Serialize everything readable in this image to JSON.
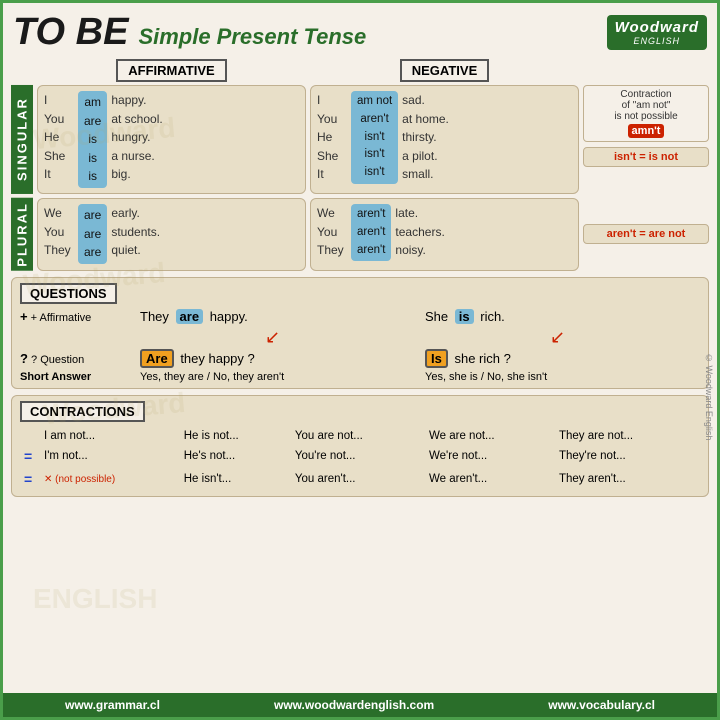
{
  "header": {
    "title_tobe": "TO BE",
    "title_sub": "Simple Present Tense",
    "logo": "Woodward",
    "logo_sub": "ENGLISH"
  },
  "col_headers": {
    "affirmative": "AFFIRMATIVE",
    "negative": "NEGATIVE"
  },
  "singular": {
    "label": "SINGULAR",
    "affirmative": {
      "pronouns": [
        "I",
        "You",
        "He",
        "She",
        "It"
      ],
      "verbs": [
        "am",
        "are",
        "is",
        "is",
        "is"
      ],
      "complements": [
        "happy.",
        "at school.",
        "hungry.",
        "a nurse.",
        "big."
      ]
    },
    "negative": {
      "pronouns": [
        "I",
        "You",
        "He",
        "She",
        "It"
      ],
      "verbs": [
        "am not",
        "aren't",
        "isn't",
        "isn't",
        "isn't"
      ],
      "complements": [
        "sad.",
        "at home.",
        "thirsty.",
        "a pilot.",
        "small."
      ]
    }
  },
  "plural": {
    "label": "PLURAL",
    "affirmative": {
      "pronouns": [
        "We",
        "You",
        "They"
      ],
      "verbs": [
        "are",
        "are",
        "are"
      ],
      "complements": [
        "early.",
        "students.",
        "quiet."
      ]
    },
    "negative": {
      "pronouns": [
        "We",
        "You",
        "They"
      ],
      "verbs": [
        "aren't",
        "aren't",
        "aren't"
      ],
      "complements": [
        "late.",
        "teachers.",
        "noisy."
      ]
    }
  },
  "notes": {
    "contraction_title": "Contraction of \"am not\" is not possible",
    "amnt": "amn't",
    "isnt_eq": "isn't = is not",
    "arent_eq": "aren't = are not"
  },
  "questions": {
    "title": "QUESTIONS",
    "affirmative_label": "+ Affirmative",
    "question_label": "? Question",
    "short_answer_label": "Short Answer",
    "aff1": "They",
    "are1": "are",
    "aff1_rest": "happy.",
    "aff2": "She",
    "is1": "is",
    "aff2_rest": "rich.",
    "q1_verb": "Are",
    "q1_rest": "they happy ?",
    "q2_verb": "Is",
    "q2_rest": "she rich ?",
    "sa1": "Yes, they are / No, they aren't",
    "sa2": "Yes, she is / No, she isn't"
  },
  "contractions": {
    "title": "CONTRACTIONS",
    "rows": {
      "long": [
        "I am not...",
        "He is not...",
        "You are not...",
        "We are not...",
        "They are not..."
      ],
      "short": [
        "I'm not...",
        "He's not...",
        "You're not...",
        "We're not...",
        "They're not..."
      ],
      "short2": [
        "✕ (not possible)",
        "He isn't...",
        "You aren't...",
        "We aren't...",
        "They aren't..."
      ]
    }
  },
  "footer": {
    "link1": "www.grammar.cl",
    "link2": "www.woodwardenglish.com",
    "link3": "www.vocabulary.cl"
  }
}
